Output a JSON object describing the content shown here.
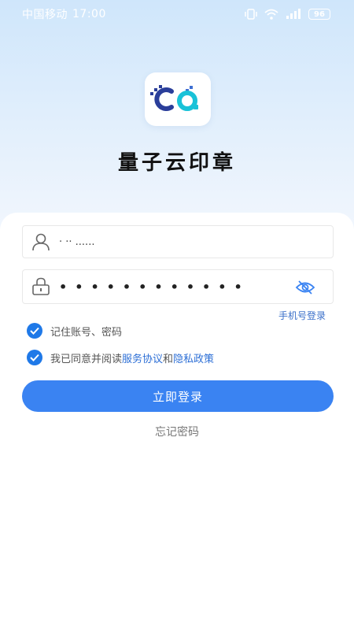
{
  "status_bar": {
    "carrier": "中国移动",
    "time": "17:00",
    "battery": "96"
  },
  "app": {
    "title": "量子云印章"
  },
  "login": {
    "username_value": "· ·· ......",
    "password_dots": "••••••••••••",
    "phone_login": "手机号登录",
    "remember_label": "记住账号、密码",
    "agree_prefix": "我已同意并阅读",
    "service_agreement": "服务协议",
    "and": "和",
    "privacy_policy": "隐私政策",
    "login_button": "立即登录",
    "forgot_password": "忘记密码"
  },
  "colors": {
    "accent": "#3a83f2",
    "link": "#2d6fd6",
    "checkbox": "#1f79e8"
  },
  "icons": {
    "username": "user-icon",
    "password": "lock-icon",
    "visibility": "eye-off-icon",
    "check": "check-icon"
  }
}
